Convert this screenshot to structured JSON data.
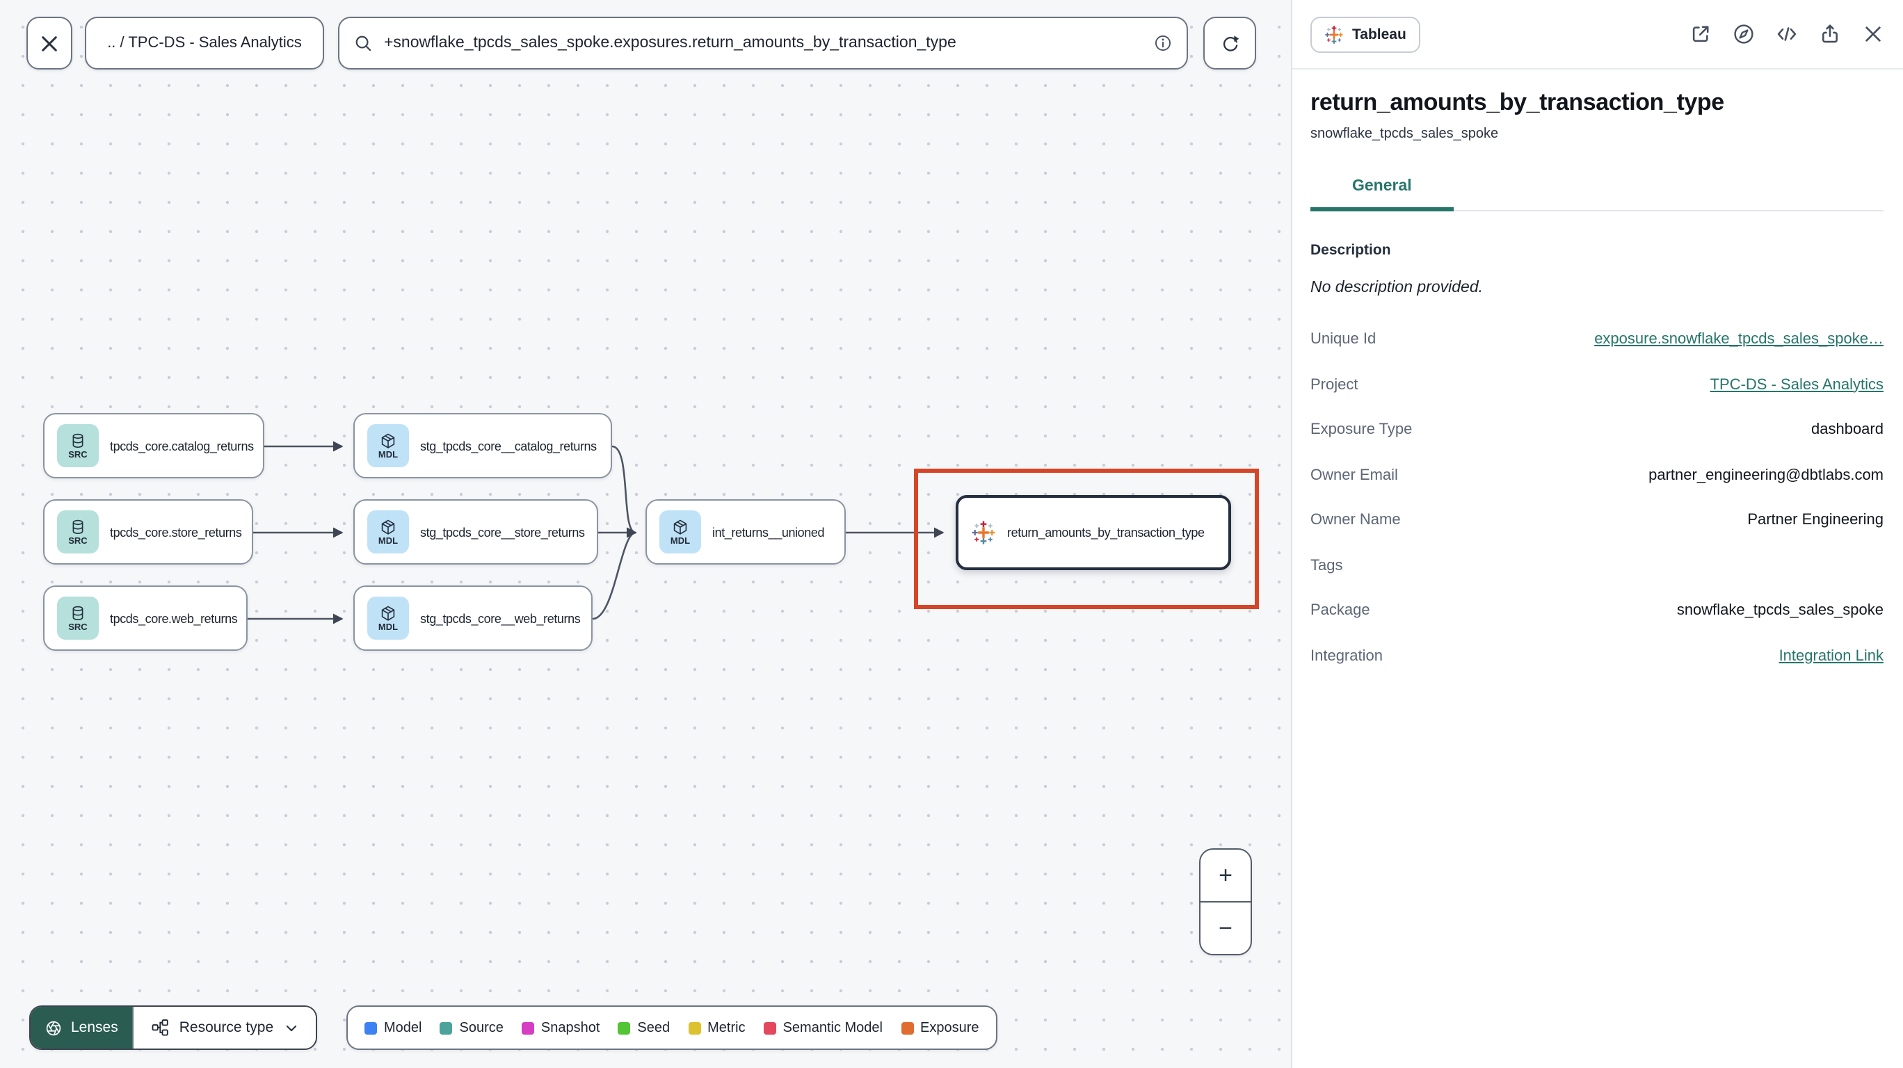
{
  "toolbar": {
    "breadcrumb": ".. / TPC-DS - Sales Analytics",
    "search_value": "+snowflake_tpcds_sales_spoke.exposures.return_amounts_by_transaction_type"
  },
  "graph": {
    "annotation_color": "#d64527",
    "nodes": [
      {
        "badge": "SRC",
        "label": "tpcds_core.catalog_returns"
      },
      {
        "badge": "SRC",
        "label": "tpcds_core.store_returns"
      },
      {
        "badge": "SRC",
        "label": "tpcds_core.web_returns"
      },
      {
        "badge": "MDL",
        "label": "stg_tpcds_core__catalog_returns"
      },
      {
        "badge": "MDL",
        "label": "stg_tpcds_core__store_returns"
      },
      {
        "badge": "MDL",
        "label": "stg_tpcds_core__web_returns"
      },
      {
        "badge": "MDL",
        "label": "int_returns__unioned"
      },
      {
        "badge": "tableau",
        "label": "return_amounts_by_transaction_type"
      }
    ]
  },
  "controls": {
    "lenses_label": "Lenses",
    "resource_type_label": "Resource type",
    "zoom_in": "+",
    "zoom_out": "−"
  },
  "legend": {
    "items": [
      {
        "label": "Model",
        "color": "#3d82f2"
      },
      {
        "label": "Source",
        "color": "#4ba39b"
      },
      {
        "label": "Snapshot",
        "color": "#d53dc2"
      },
      {
        "label": "Seed",
        "color": "#53c434"
      },
      {
        "label": "Metric",
        "color": "#ddc230"
      },
      {
        "label": "Semantic Model",
        "color": "#e4485c"
      },
      {
        "label": "Exposure",
        "color": "#df6d31"
      }
    ]
  },
  "panel": {
    "badge": "Tableau",
    "title": "return_amounts_by_transaction_type",
    "subtitle": "snowflake_tpcds_sales_spoke",
    "tab": "General",
    "description_label": "Description",
    "description_value": "No description provided.",
    "accent_color": "#26756a",
    "fields": [
      {
        "label": "Unique Id",
        "value": "exposure.snowflake_tpcds_sales_spoke…"
      },
      {
        "label": "Project",
        "value": "TPC-DS - Sales Analytics"
      },
      {
        "label": "Exposure Type",
        "value": "dashboard"
      },
      {
        "label": "Owner Email",
        "value": "partner_engineering@dbtlabs.com"
      },
      {
        "label": "Owner Name",
        "value": "Partner Engineering"
      },
      {
        "label": "Tags",
        "value": ""
      },
      {
        "label": "Package",
        "value": "snowflake_tpcds_sales_spoke"
      },
      {
        "label": "Integration",
        "value": "Integration Link"
      }
    ]
  }
}
